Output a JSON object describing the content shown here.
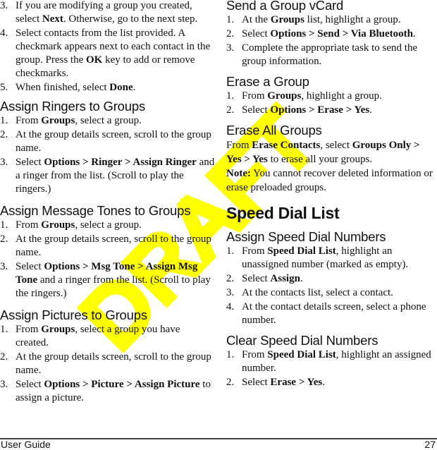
{
  "watermark": {
    "text": "DRAFT",
    "color": "#FFFF00"
  },
  "left_column": {
    "continued_steps": [
      {
        "num": "3.",
        "parts": [
          {
            "t": "If you are modifying a group you created, select "
          },
          {
            "b": "Next"
          },
          {
            "t": ". Otherwise, go to the next step."
          }
        ]
      },
      {
        "num": "4.",
        "parts": [
          {
            "t": "Select contacts from the list provided. A checkmark appears next to each contact in the group. Press the "
          },
          {
            "b": "OK"
          },
          {
            "t": " key to add or remove checkmarks."
          }
        ]
      },
      {
        "num": "5.",
        "parts": [
          {
            "t": "When finished, select "
          },
          {
            "b": "Done"
          },
          {
            "t": "."
          }
        ]
      }
    ],
    "sections": [
      {
        "heading": "Assign Ringers to Groups",
        "steps": [
          {
            "num": "1.",
            "parts": [
              {
                "t": "From "
              },
              {
                "b": "Groups"
              },
              {
                "t": ", select a group."
              }
            ]
          },
          {
            "num": "2.",
            "parts": [
              {
                "t": "At the group details screen, scroll to the group name."
              }
            ]
          },
          {
            "num": "3.",
            "parts": [
              {
                "t": "Select "
              },
              {
                "b": "Options > Ringer > Assign Ringer"
              },
              {
                "t": " and a ringer from the list. (Scroll to play the ringers.)"
              }
            ]
          }
        ]
      },
      {
        "heading": "Assign Message Tones to Groups",
        "steps": [
          {
            "num": "1.",
            "parts": [
              {
                "t": "From "
              },
              {
                "b": "Groups"
              },
              {
                "t": ", select a group."
              }
            ]
          },
          {
            "num": "2.",
            "parts": [
              {
                "t": "At the group details screen, scroll to the group name."
              }
            ]
          },
          {
            "num": "3.",
            "parts": [
              {
                "t": "Select "
              },
              {
                "b": "Options > Msg Tone > Assign Msg Tone"
              },
              {
                "t": " and a ringer from the list. (Scroll to play the ringers.)"
              }
            ]
          }
        ]
      },
      {
        "heading": "Assign Pictures to Groups",
        "steps": [
          {
            "num": "1.",
            "parts": [
              {
                "t": "From "
              },
              {
                "b": "Groups"
              },
              {
                "t": ", select a group you have created."
              }
            ]
          },
          {
            "num": "2.",
            "parts": [
              {
                "t": "At the group details screen, scroll to the group name."
              }
            ]
          },
          {
            "num": "3.",
            "parts": [
              {
                "t": "Select "
              },
              {
                "b": "Options > Picture > Assign Picture"
              },
              {
                "t": " to assign a picture."
              }
            ]
          }
        ]
      }
    ]
  },
  "right_column": {
    "send_vcard": {
      "heading": "Send a Group vCard",
      "steps": [
        {
          "num": "1.",
          "parts": [
            {
              "t": "At the "
            },
            {
              "b": "Groups"
            },
            {
              "t": " list, highlight a group."
            }
          ]
        },
        {
          "num": "2.",
          "parts": [
            {
              "t": "Select "
            },
            {
              "b": "Options > Send > Via Bluetooth"
            },
            {
              "t": "."
            }
          ]
        },
        {
          "num": "3.",
          "parts": [
            {
              "t": "Complete the appropriate task to send the group information."
            }
          ]
        }
      ]
    },
    "erase_group": {
      "heading": "Erase a Group",
      "steps": [
        {
          "num": "1.",
          "parts": [
            {
              "t": "From "
            },
            {
              "b": "Groups"
            },
            {
              "t": ", highlight a group."
            }
          ]
        },
        {
          "num": "2.",
          "parts": [
            {
              "t": "Select "
            },
            {
              "b": "Options > Erase > Yes"
            },
            {
              "t": "."
            }
          ]
        }
      ]
    },
    "erase_all": {
      "heading": "Erase All Groups",
      "paragraph": [
        {
          "t": "From "
        },
        {
          "b": "Erase Contacts"
        },
        {
          "t": ", select "
        },
        {
          "b": "Groups Only > Yes > Yes"
        },
        {
          "t": " to erase all your groups."
        }
      ],
      "note": [
        {
          "b": "Note:"
        },
        {
          "t": " You cannot recover deleted information or erase preloaded groups."
        }
      ]
    },
    "speed_dial_title": "Speed Dial List",
    "assign_speed": {
      "heading": "Assign Speed Dial Numbers",
      "steps": [
        {
          "num": "1.",
          "parts": [
            {
              "t": "From "
            },
            {
              "b": "Speed Dial List"
            },
            {
              "t": ", highlight an unassigned number (marked as empty)."
            }
          ]
        },
        {
          "num": "2.",
          "parts": [
            {
              "t": "Select "
            },
            {
              "b": "Assign"
            },
            {
              "t": "."
            }
          ]
        },
        {
          "num": "3.",
          "parts": [
            {
              "t": "At the contacts list, select a contact."
            }
          ]
        },
        {
          "num": "4.",
          "parts": [
            {
              "t": "At the contact details screen, select a phone number."
            }
          ]
        }
      ]
    },
    "clear_speed": {
      "heading": "Clear Speed Dial Numbers",
      "steps": [
        {
          "num": "1.",
          "parts": [
            {
              "t": "From "
            },
            {
              "b": "Speed Dial List"
            },
            {
              "t": ", highlight an assigned number."
            }
          ]
        },
        {
          "num": "2.",
          "parts": [
            {
              "t": "Select "
            },
            {
              "b": "Erase > Yes"
            },
            {
              "t": "."
            }
          ]
        }
      ]
    }
  },
  "footer": {
    "left": "User Guide",
    "page_number": "27"
  }
}
